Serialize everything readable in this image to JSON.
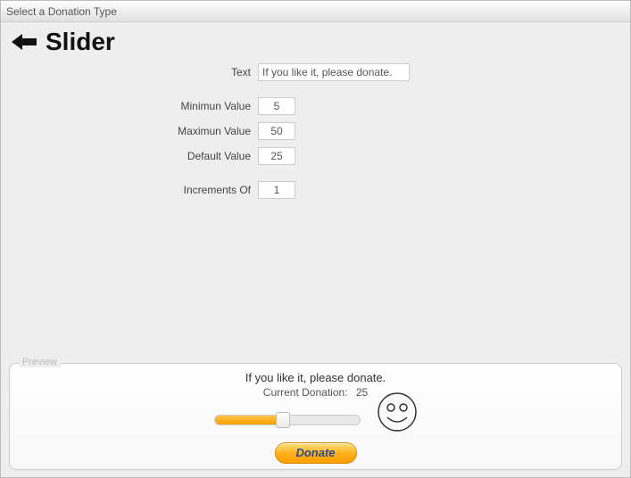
{
  "window": {
    "title": "Select a Donation Type"
  },
  "header": {
    "title": "Slider"
  },
  "form": {
    "text": {
      "label": "Text",
      "value": "If you like it, please donate."
    },
    "min": {
      "label": "Minimun Value",
      "value": "5"
    },
    "max": {
      "label": "Maximun Value",
      "value": "50"
    },
    "default": {
      "label": "Default Value",
      "value": "25"
    },
    "increments": {
      "label": "Increments Of",
      "value": "1"
    }
  },
  "preview": {
    "legend": "Preview",
    "text": "If you like it, please donate.",
    "current_label": "Current Donation:",
    "current_value": "25",
    "donate_label": "Donate"
  }
}
